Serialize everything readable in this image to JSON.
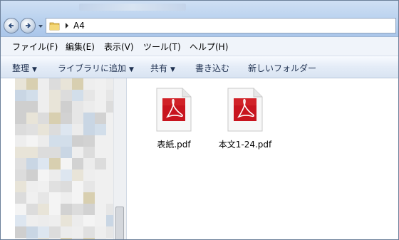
{
  "address": {
    "path": "A4"
  },
  "menu": [
    "ファイル(F)",
    "編集(E)",
    "表示(V)",
    "ツール(T)",
    "ヘルプ(H)"
  ],
  "commands": [
    {
      "label": "整理",
      "dropdown": true
    },
    {
      "label": "ライブラリに追加",
      "dropdown": true
    },
    {
      "label": "共有",
      "dropdown": true
    },
    {
      "label": "書き込む",
      "dropdown": false
    },
    {
      "label": "新しいフォルダー",
      "dropdown": false
    }
  ],
  "files": [
    {
      "name": "表紙.pdf",
      "icon": "pdf-icon"
    },
    {
      "name": "本文1-24.pdf",
      "icon": "pdf-icon"
    }
  ],
  "colors": {
    "pdf_red": "#c8141e",
    "accent": "#b9d1ee"
  }
}
